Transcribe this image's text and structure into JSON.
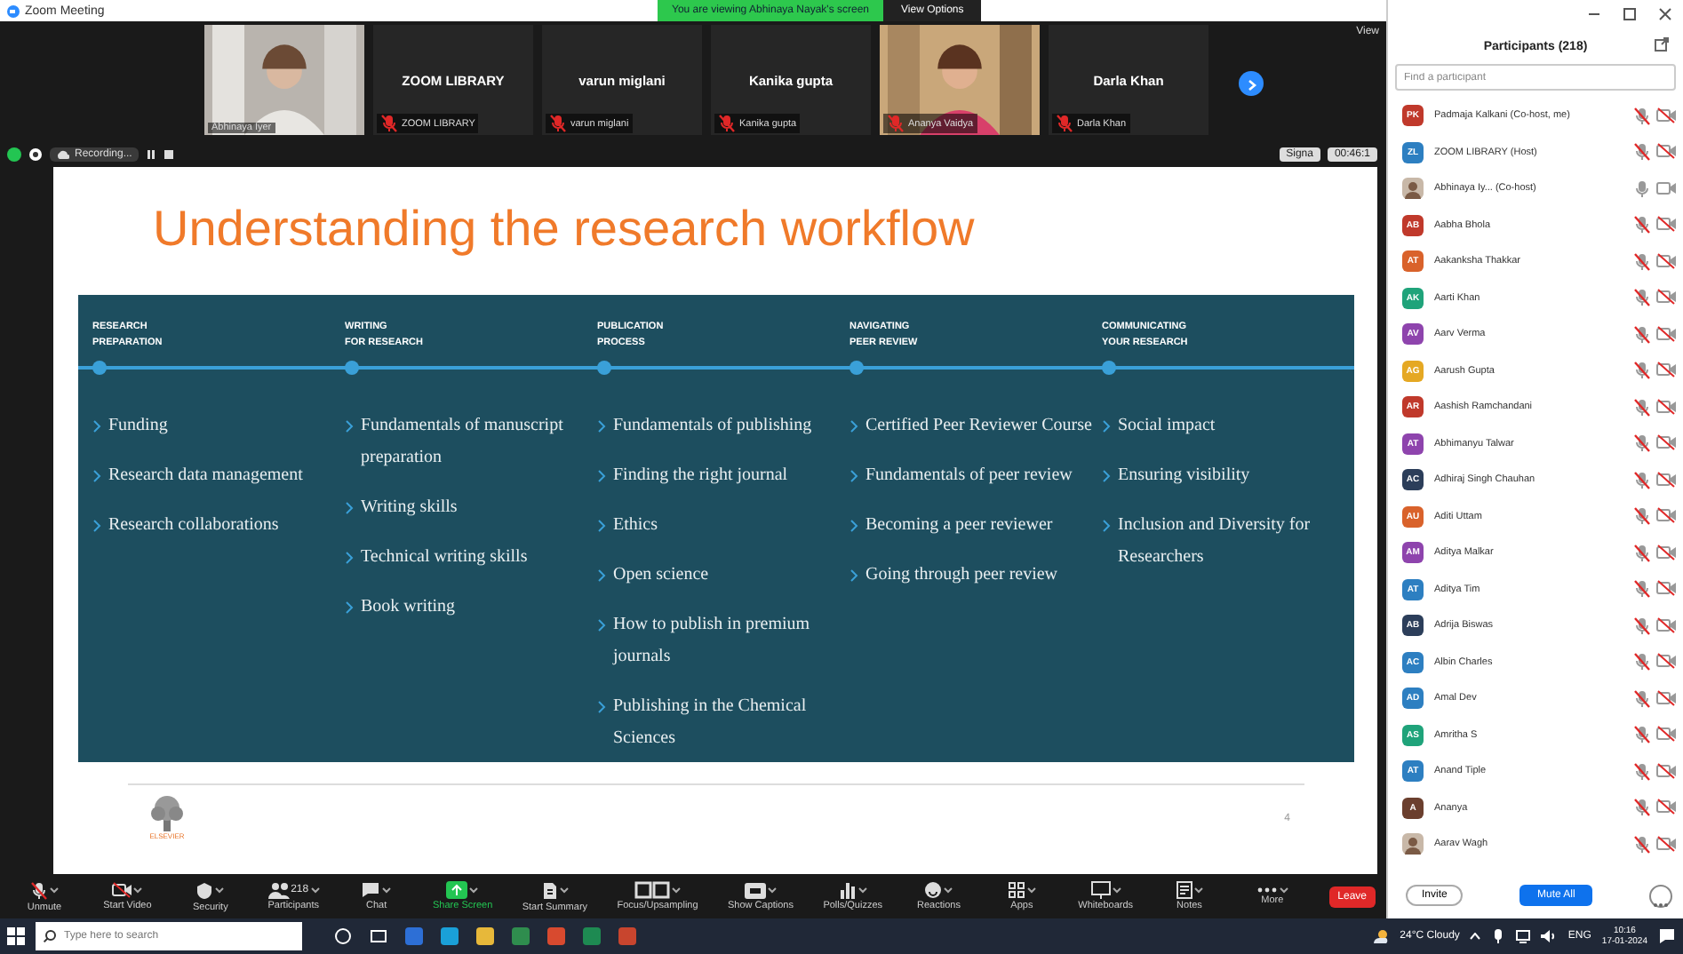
{
  "window": {
    "title": "Zoom Meeting"
  },
  "share_banner": {
    "text": "You are viewing Abhinaya Nayak's screen",
    "button": "View Options"
  },
  "gallery": {
    "tiles": [
      {
        "kind": "video",
        "name": "Abhinaya Iyer",
        "muted": false
      },
      {
        "kind": "name",
        "title": "ZOOM LIBRARY",
        "name": "ZOOM LIBRARY",
        "muted": true
      },
      {
        "kind": "name",
        "title": "varun miglani",
        "name": "varun miglani",
        "muted": true
      },
      {
        "kind": "name",
        "title": "Kanika gupta",
        "name": "Kanika gupta",
        "muted": true
      },
      {
        "kind": "video",
        "name": "Ananya Vaidya",
        "muted": true
      },
      {
        "kind": "name",
        "title": "Darla Khan",
        "name": "Darla Khan",
        "muted": true
      }
    ],
    "view_label": "View"
  },
  "share_bar": {
    "recording": "Recording...",
    "buttons": [
      "Signa",
      "00:46:1"
    ]
  },
  "slide": {
    "title": "Understanding the research workflow",
    "columns": [
      {
        "heading": "RESEARCH\nPREPARATION",
        "items": [
          "Funding",
          "Research data management",
          "Research collaborations"
        ]
      },
      {
        "heading": "WRITING\nFOR RESEARCH",
        "items": [
          "Fundamentals of manuscript preparation",
          "Writing skills",
          "Technical writing skills",
          "Book writing"
        ]
      },
      {
        "heading": "PUBLICATION\nPROCESS",
        "items": [
          "Fundamentals of publishing",
          "Finding the right journal",
          "Ethics",
          "Open science",
          "How to publish in premium journals",
          "Publishing in the Chemical Sciences"
        ]
      },
      {
        "heading": "NAVIGATING\nPEER REVIEW",
        "items": [
          "Certified Peer Reviewer Course",
          "Fundamentals of peer review",
          "Becoming a peer reviewer",
          "Going through peer review"
        ]
      },
      {
        "heading": "COMMUNICATING\nYOUR RESEARCH",
        "items": [
          "Social impact",
          "Ensuring visibility",
          "Inclusion and Diversity for Researchers"
        ]
      }
    ],
    "logo_text": "ELSEVIER",
    "page": "4"
  },
  "toolbar": {
    "items": [
      {
        "label": "Unmute",
        "active": false
      },
      {
        "label": "Start Video",
        "active": false
      },
      {
        "label": "Security",
        "active": false
      },
      {
        "label": "Participants",
        "count": "218",
        "active": false
      },
      {
        "label": "Chat",
        "active": false
      },
      {
        "label": "Share Screen",
        "active": true
      },
      {
        "label": "Start Summary",
        "active": false
      },
      {
        "label": "Focus/Upsampling",
        "active": false
      },
      {
        "label": "Show Captions",
        "active": false
      },
      {
        "label": "Polls/Quizzes",
        "active": false
      },
      {
        "label": "Reactions",
        "active": false
      },
      {
        "label": "Apps",
        "active": false
      },
      {
        "label": "Whiteboards",
        "active": false
      },
      {
        "label": "Notes",
        "active": false
      },
      {
        "label": "More",
        "active": false
      }
    ],
    "leave": "Leave"
  },
  "participants": {
    "title": "Participants (218)",
    "search": {
      "placeholder": "Find a participant"
    },
    "rows": [
      {
        "kind": "initials",
        "initials": "PK",
        "name": "Padmaja Kalkani (Co-host, me)",
        "color": "#c0392b",
        "muted": true,
        "video_off": true
      },
      {
        "kind": "initials",
        "initials": "ZL",
        "name": "ZOOM LIBRARY (Host)",
        "color": "#2d7fc1",
        "muted": true,
        "video_off": true
      },
      {
        "name": "Abhinaya Iy... (Co-host)",
        "muted": false,
        "video_off": false
      },
      {
        "kind": "initials",
        "initials": "AB",
        "name": "Aabha Bhola",
        "color": "#c0392b",
        "muted": true,
        "video_off": true
      },
      {
        "kind": "initials",
        "initials": "AT",
        "name": "Aakanksha Thakkar",
        "color": "#d9622b",
        "muted": true,
        "video_off": true
      },
      {
        "kind": "initials",
        "initials": "AK",
        "name": "Aarti Khan",
        "color": "#1fa37a",
        "muted": true,
        "video_off": true
      },
      {
        "kind": "initials",
        "initials": "AV",
        "name": "Aarv Verma",
        "color": "#8e44ad",
        "muted": true,
        "video_off": true
      },
      {
        "kind": "initials",
        "initials": "AG",
        "name": "Aarush Gupta",
        "color": "#e5a823",
        "muted": true,
        "video_off": true
      },
      {
        "kind": "initials",
        "initials": "AR",
        "name": "Aashish Ramchandani",
        "color": "#c0392b",
        "muted": true,
        "video_off": true
      },
      {
        "kind": "initials",
        "initials": "AT",
        "name": "Abhimanyu Talwar",
        "color": "#8e44ad",
        "muted": true,
        "video_off": true
      },
      {
        "kind": "initials",
        "initials": "AC",
        "name": "Adhiraj Singh Chauhan",
        "color": "#2c3e5a",
        "muted": true,
        "video_off": true
      },
      {
        "kind": "initials",
        "initials": "AU",
        "name": "Aditi Uttam",
        "color": "#d9622b",
        "muted": true,
        "video_off": true
      },
      {
        "kind": "initials",
        "initials": "AM",
        "name": "Aditya Malkar",
        "color": "#8e44ad",
        "muted": true,
        "video_off": true
      },
      {
        "kind": "initials",
        "initials": "AT",
        "name": "Aditya Tim",
        "color": "#2d7fc1",
        "muted": true,
        "video_off": true
      },
      {
        "kind": "initials",
        "initials": "AB",
        "name": "Adrija Biswas",
        "color": "#2c3e5a",
        "muted": true,
        "video_off": true
      },
      {
        "kind": "initials",
        "initials": "AC",
        "name": "Albin Charles",
        "color": "#2d7fc1",
        "muted": true,
        "video_off": true
      },
      {
        "kind": "initials",
        "initials": "AD",
        "name": "Amal Dev",
        "color": "#2d7fc1",
        "muted": true,
        "video_off": true
      },
      {
        "kind": "initials",
        "initials": "AS",
        "name": "Amritha S",
        "color": "#1fa37a",
        "muted": true,
        "video_off": true
      },
      {
        "kind": "initials",
        "initials": "AT",
        "name": "Anand Tiple",
        "color": "#2d7fc1",
        "muted": true,
        "video_off": true
      },
      {
        "kind": "initials",
        "initials": "A",
        "name": "Ananya",
        "color": "#6b3f2e",
        "muted": true,
        "video_off": true
      },
      {
        "name": "Aarav Wagh",
        "muted": true,
        "video_off": true
      }
    ],
    "buttons": [
      "Invite",
      "Mute All"
    ]
  },
  "taskbar": {
    "search": {
      "placeholder": "Type here to search"
    },
    "weather": "24°C Cloudy",
    "lang": "ENG",
    "time": "10:16",
    "date": "17-01-2024"
  }
}
